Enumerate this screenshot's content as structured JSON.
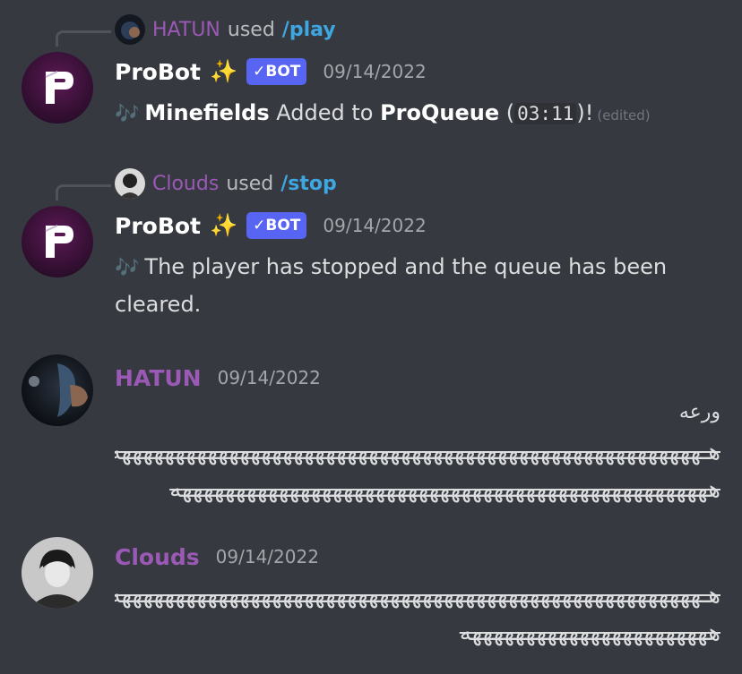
{
  "messages": [
    {
      "reply": {
        "user": "HATUN",
        "used": "used",
        "command": "/play"
      },
      "author": "ProBot",
      "sparkle": "✨",
      "badge": "✓BOT",
      "timestamp": "09/14/2022",
      "notes": "🎶",
      "song": "Minefields",
      "text1": " Added to ",
      "queue": "ProQueue",
      "paren_open": " (",
      "duration": "03:11",
      "paren_close": ")!",
      "edited": "(edited)"
    },
    {
      "reply": {
        "user": "Clouds",
        "used": "used",
        "command": "/stop"
      },
      "author": "ProBot",
      "sparkle": "✨",
      "badge": "✓BOT",
      "timestamp": "09/14/2022",
      "notes": "🎶",
      "text": "The player has stopped and the queue has been cleared."
    },
    {
      "author": "HATUN",
      "timestamp": "09/14/2022",
      "line1": "ورعه",
      "line2": "هـههههههههههههههههههههههههههههههههههههههههههههههههههههههه",
      "line3": "ههههههههههههههههههههههههههههههههههههههههههههههههههه"
    },
    {
      "author": "Clouds",
      "timestamp": "09/14/2022",
      "line1": "هـههههههههههههههههههههههههههههههههههههههههههههههههههههههه",
      "line2": "هههههههههههههههههههههههه"
    }
  ],
  "colors": {
    "background": "#36393f",
    "bot_badge": "#5865f2",
    "username_purple": "#9b59b6",
    "command_blue": "#3ea6e0"
  }
}
